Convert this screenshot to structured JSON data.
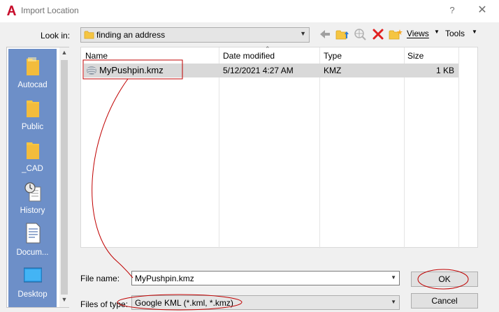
{
  "window": {
    "title": "Import Location",
    "help": "?",
    "close": "✕"
  },
  "lookin": {
    "label": "Look in:",
    "value": "finding an address"
  },
  "toolbar": {
    "views": "Views",
    "tools": "Tools"
  },
  "places": [
    "Autocad",
    "Public",
    "_CAD",
    "History",
    "Docum...",
    "Desktop"
  ],
  "columns": {
    "name": "Name",
    "date": "Date modified",
    "type": "Type",
    "size": "Size"
  },
  "files": [
    {
      "name": "MyPushpin.kmz",
      "date": "5/12/2021 4:27 AM",
      "type": "KMZ",
      "size": "1 KB"
    }
  ],
  "filename": {
    "label": "File name:",
    "value": "MyPushpin.kmz"
  },
  "filetype": {
    "label": "Files of type:",
    "value": "Google KML (*.kml, *.kmz)"
  },
  "buttons": {
    "ok": "OK",
    "cancel": "Cancel"
  },
  "colors": {
    "sidebar": "#6d8fc8",
    "annotation": "#c00000",
    "selection": "#d9d9d9",
    "brand": "#c8102e"
  }
}
